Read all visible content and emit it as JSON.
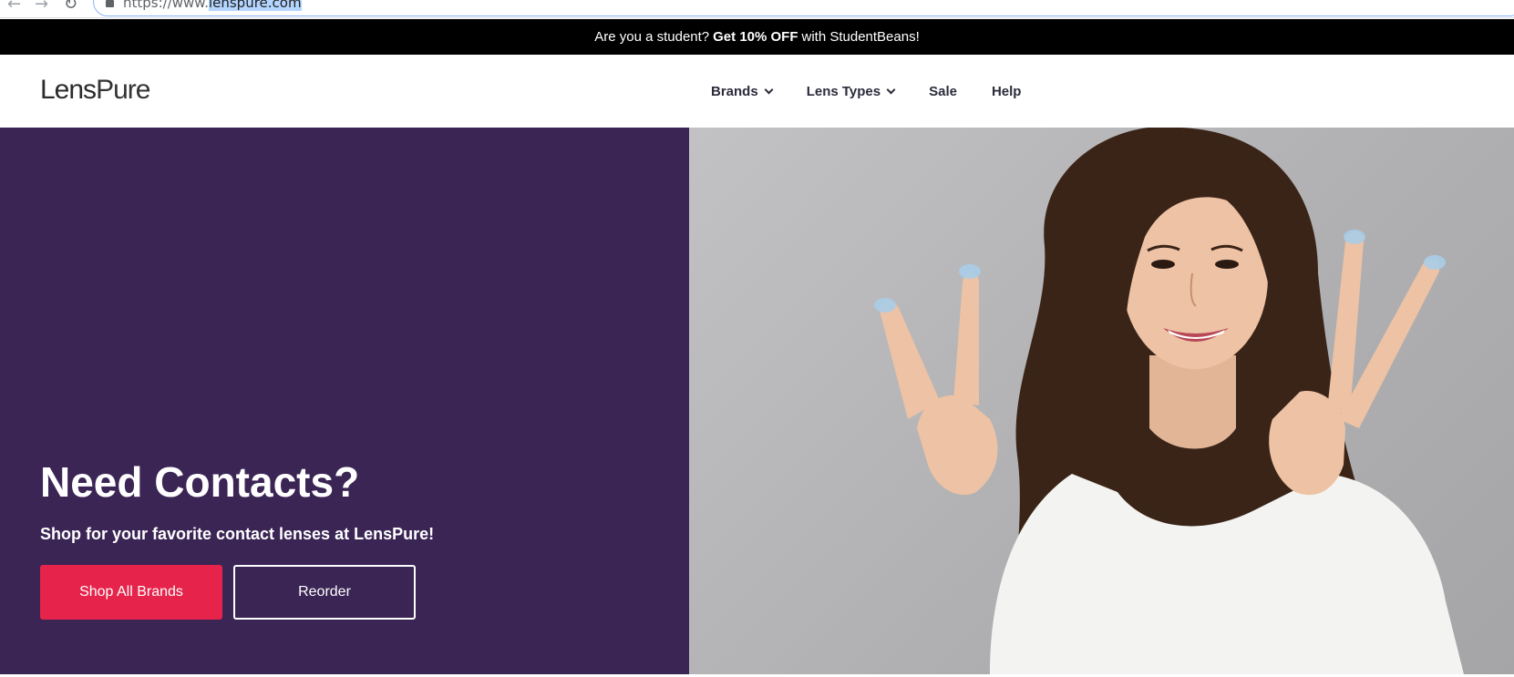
{
  "browser": {
    "url_prefix": "https://www.",
    "url_highlight": "lenspure.com"
  },
  "promo": {
    "text_before": "Are you a student?",
    "text_bold": "Get 10% OFF",
    "text_after": "with StudentBeans!"
  },
  "header": {
    "logo_left": "Lens",
    "logo_right": "Pure",
    "nav": [
      {
        "label": "Brands",
        "icon": "chevron-down-icon"
      },
      {
        "label": "Lens Types",
        "icon": "chevron-down-icon"
      },
      {
        "label": "Sale"
      },
      {
        "label": "Help"
      }
    ]
  },
  "hero": {
    "title": "Need Contacts?",
    "subtitle": "Shop for your favorite contact lenses at LensPure!",
    "primary_button": "Shop All Brands",
    "secondary_button": "Reorder"
  },
  "colors": {
    "promo_bg": "#000000",
    "hero_bg": "#3b2555",
    "primary_button": "#e6244b",
    "photo_bg": "#b4b4b6"
  }
}
